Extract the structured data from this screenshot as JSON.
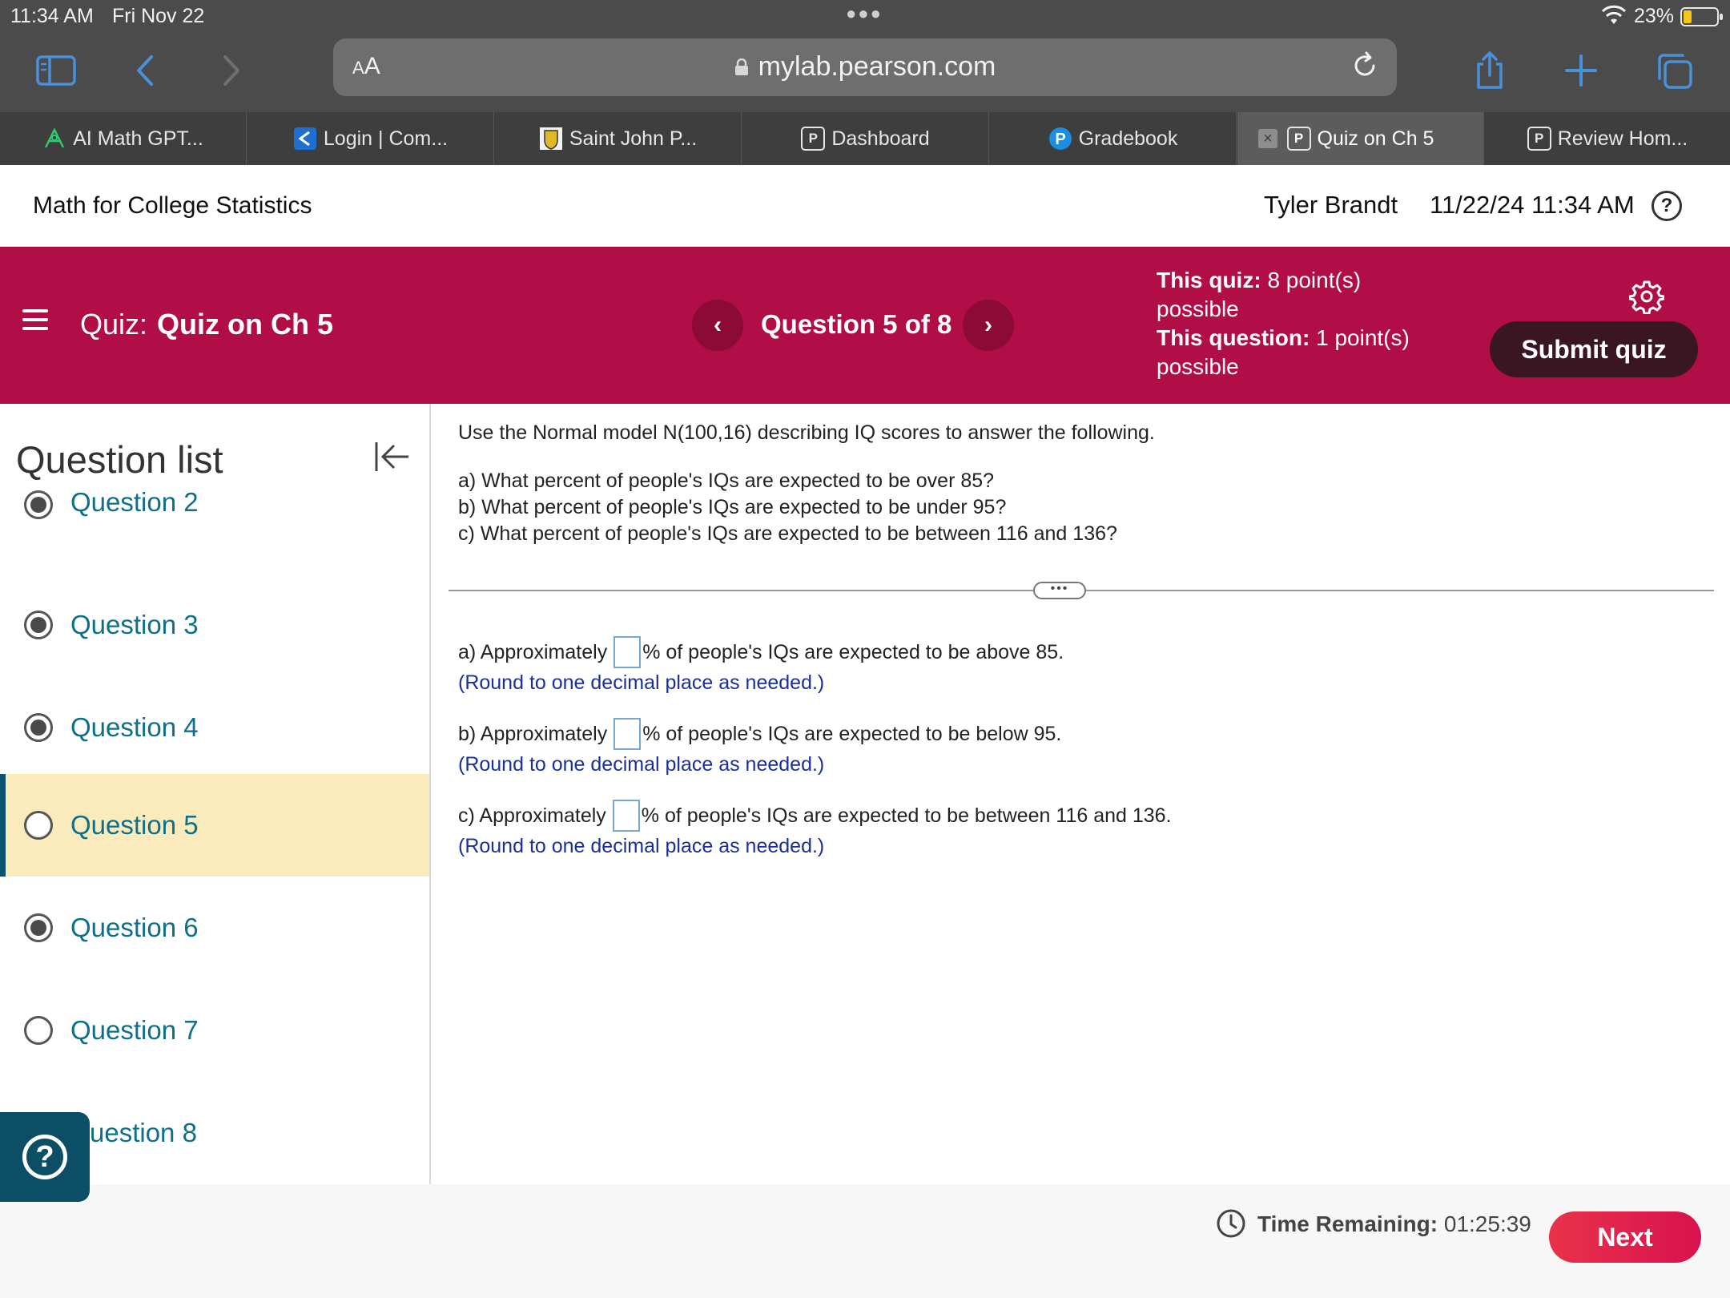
{
  "status_bar": {
    "time": "11:34 AM",
    "date": "Fri Nov 22",
    "battery_percent": "23%",
    "battery_level": 0.23,
    "battery_color": "#f5c518"
  },
  "browser": {
    "url": "mylab.pearson.com",
    "text_size_label": "AA",
    "icons": [
      "sidebar-icon",
      "back-icon",
      "forward-icon",
      "lock-icon",
      "reload-icon",
      "share-icon",
      "new-tab-icon",
      "tabs-overview-icon"
    ]
  },
  "tabs": [
    {
      "label": "AI Math GPT...",
      "icon": "ai-math-icon"
    },
    {
      "label": "Login | Com...",
      "icon": "login-icon"
    },
    {
      "label": "Saint John P...",
      "icon": "school-crest-icon"
    },
    {
      "label": "Dashboard",
      "icon": "pearson-p-icon"
    },
    {
      "label": "Gradebook",
      "icon": "pearson-logo-icon"
    },
    {
      "label": "Quiz on Ch 5",
      "icon": "pearson-p-icon",
      "active": true
    },
    {
      "label": "Review Hom...",
      "icon": "pearson-p-icon"
    }
  ],
  "header": {
    "course_title": "Math for College Statistics",
    "user_name": "Tyler Brandt",
    "datetime": "11/22/24 11:34 AM",
    "help_symbol": "?"
  },
  "banner": {
    "quiz_prefix": "Quiz:",
    "quiz_name": "Quiz on Ch 5",
    "question_position": "Question 5 of 8",
    "this_quiz_label": "This quiz:",
    "this_quiz_value": "8 point(s)",
    "this_quiz_suffix": "possible",
    "this_question_label": "This question:",
    "this_question_value": "1 point(s)",
    "this_question_suffix": "possible",
    "submit_label": "Submit quiz",
    "accent_color": "#b10e47"
  },
  "sidebar": {
    "title": "Question list",
    "questions": [
      {
        "label": "Question 2",
        "status": "answered"
      },
      {
        "label": "Question 3",
        "status": "answered"
      },
      {
        "label": "Question 4",
        "status": "answered"
      },
      {
        "label": "Question 5",
        "status": "current"
      },
      {
        "label": "Question 6",
        "status": "answered"
      },
      {
        "label": "Question 7",
        "status": "unanswered"
      },
      {
        "label": "uestion 8",
        "status": "unanswered"
      }
    ],
    "help_symbol": "?"
  },
  "question": {
    "prompt": "Use the Normal model N(100,16) describing IQ scores to answer the following.",
    "parts": [
      "a) What percent of people's IQs are expected to be over 85?",
      "b) What percent of people's IQs are expected to be under 95?",
      "c) What percent of people's IQs are expected to be between 116 and 136?"
    ],
    "divider_handle": "•••",
    "answers": [
      {
        "before": "a) Approximately",
        "after": "% of people's IQs are expected to be above 85.",
        "value": "",
        "hint": "(Round to one decimal place as needed.)"
      },
      {
        "before": "b) Approximately",
        "after": "% of people's IQs are expected to be below 95.",
        "value": "",
        "hint": "(Round to one decimal place as needed.)"
      },
      {
        "before": "c) Approximately",
        "after": "% of people's IQs are expected to be between 116 and 136.",
        "value": "",
        "hint": "(Round to one decimal place as needed.)"
      }
    ]
  },
  "footer": {
    "time_label": "Time Remaining:",
    "time_value": "01:25:39",
    "next_label": "Next"
  }
}
